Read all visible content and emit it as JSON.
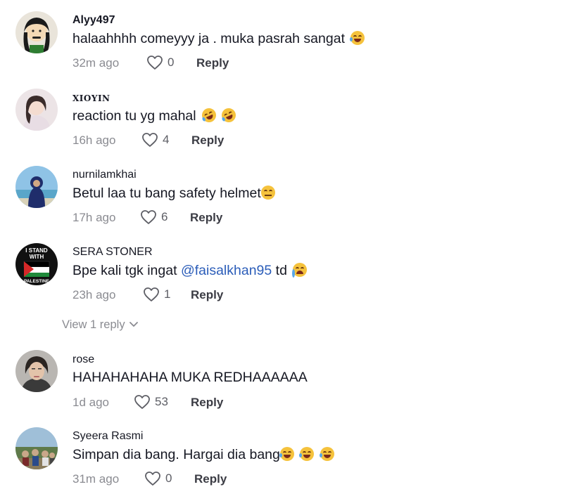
{
  "comments": [
    {
      "username": "Alyy497",
      "text": "halaahhhh comeyyy ja . muka pasrah sangat",
      "emoji": [
        "face-with-tears-of-joy"
      ],
      "time": "32m ago",
      "likes": "0",
      "reply": "Reply"
    },
    {
      "username": "XIOYIN",
      "text": "reaction tu yg mahal",
      "emoji": [
        "rolling-on-floor-laughing",
        "rolling-on-floor-laughing"
      ],
      "time": "16h ago",
      "likes": "4",
      "reply": "Reply"
    },
    {
      "username": "nurnilamkhai",
      "text": "Betul laa tu bang safety helmet",
      "emoji": [
        "relieved-face"
      ],
      "time": "17h ago",
      "likes": "6",
      "reply": "Reply"
    },
    {
      "username": "SERA STONER",
      "text_before": "Bpe kali tgk ingat ",
      "mention": "@faisalkhan95",
      "text_after": " td",
      "emoji": [
        "loudly-crying-face"
      ],
      "time": "23h ago",
      "likes": "1",
      "reply": "Reply",
      "avatar_text": "I STAND WITH PALESTINE"
    },
    {
      "username": "rose",
      "text": "HAHAHAHAHA MUKA REDHAAAAAA",
      "time": "1d ago",
      "likes": "53",
      "reply": "Reply"
    },
    {
      "username": "Syeera Rasmi",
      "text": "Simpan dia bang. Hargai dia bang",
      "emoji": [
        "face-with-tears-of-joy",
        "face-with-tears-of-joy",
        "face-with-tears-of-joy"
      ],
      "time": "31m ago",
      "likes": "0",
      "reply": "Reply"
    }
  ],
  "view_replies": {
    "label": "View 1 reply",
    "icon": "chevron-down-icon"
  },
  "colors": {
    "text": "#161823",
    "muted": "#8a8b91",
    "mention": "#2b5db9",
    "reply": "#3b3c44"
  }
}
